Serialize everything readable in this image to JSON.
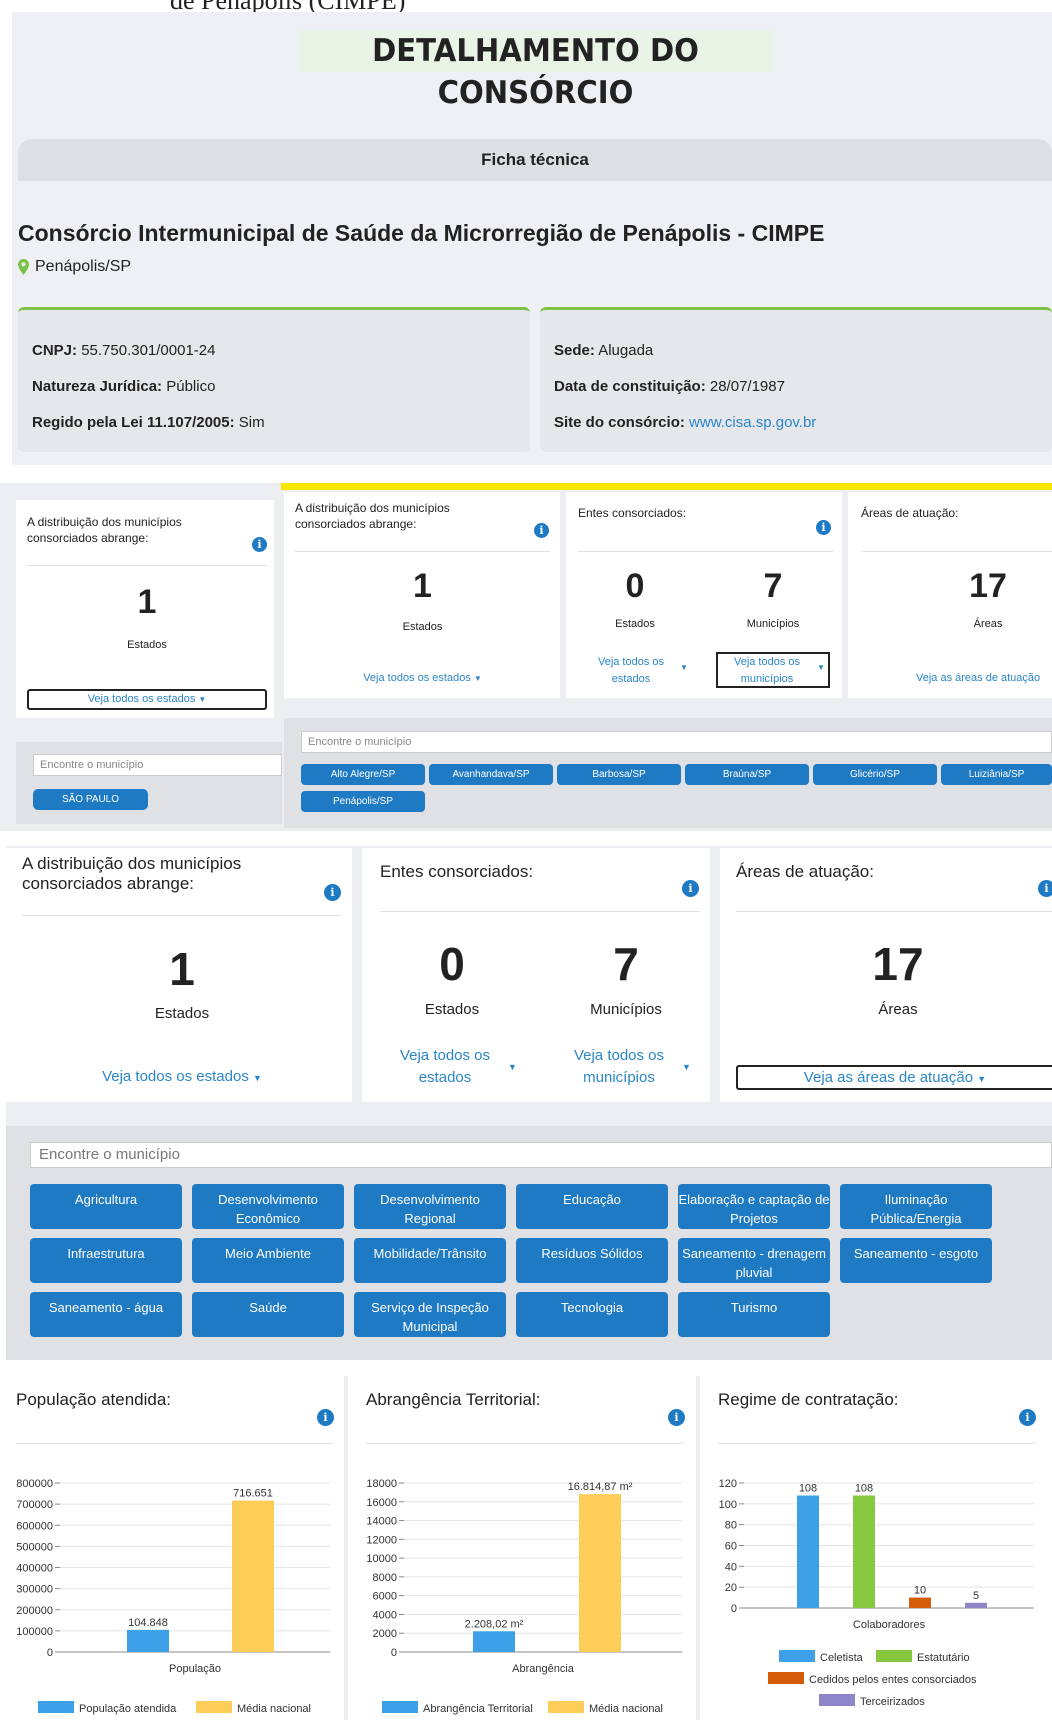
{
  "caption_fragment": "de Penápolis (CIMPE)",
  "header": {
    "title": "DETALHAMENTO DO CONSÓRCIO",
    "tab": "Ficha técnica"
  },
  "consortium": {
    "name": "Consórcio Intermunicipal de Saúde da Microrregião de Penápolis - CIMPE",
    "location": "Penápolis/SP"
  },
  "ficha": {
    "cnpj_label": "CNPJ:",
    "cnpj": "55.750.301/0001-24",
    "natureza_label": "Natureza Jurídica:",
    "natureza": "Público",
    "lei_label": "Regido pela Lei 11.107/2005:",
    "lei": "Sim",
    "sede_label": "Sede:",
    "sede": "Alugada",
    "data_label": "Data de constituição:",
    "data": "28/07/1987",
    "site_label": "Site do consórcio:",
    "site": "www.cisa.sp.gov.br"
  },
  "mid": {
    "dist_label": "A distribuição dos municípios consorciados abrange:",
    "estados_count": "1",
    "estados_label": "Estados",
    "veja_estados": "Veja todos os estados",
    "entes_label": "Entes consorciados:",
    "entes_estados": "0",
    "entes_municipios": "7",
    "municipios_label": "Municípios",
    "veja_estados2": "Veja todos os estados",
    "veja_municipios": "Veja todos os municípios",
    "areas_label": "Áreas de atuação:",
    "areas_count": "17",
    "areas_unit": "Áreas",
    "veja_areas": "Veja as áreas de atuação",
    "search_placeholder": "Encontre o município",
    "state_button": "SÃO PAULO",
    "municipios": [
      "Alto Alegre/SP",
      "Avanhandava/SP",
      "Barbosa/SP",
      "Braúna/SP",
      "Glicério/SP",
      "Luiziânia/SP",
      "Penápolis/SP"
    ]
  },
  "big": {
    "dist_label": "A distribuição dos municípios consorciados abrange:",
    "estados_count": "1",
    "estados_label": "Estados",
    "veja_estados": "Veja todos os estados",
    "entes_label": "Entes consorciados:",
    "entes_estados": "0",
    "entes_municipios": "7",
    "estados_label2": "Estados",
    "municipios_label": "Municípios",
    "veja_estados2": "Veja todos os estados",
    "veja_municipios": "Veja todos os municípios",
    "areas_label": "Áreas de atuação:",
    "areas_count": "17",
    "areas_unit": "Áreas",
    "veja_areas": "Veja as áreas de atuação",
    "search_placeholder": "Encontre o município",
    "areas": [
      "Agricultura",
      "Desenvolvimento Econômico",
      "Desenvolvimento Regional",
      "Educação",
      "Elaboração e captação de Projetos",
      "Iluminação Pública/Energia",
      "Infraestrutura",
      "Meio Ambiente",
      "Mobilidade/Trânsito",
      "Resíduos Sólidos",
      "Saneamento - drenagem pluvial",
      "Saneamento - esgoto",
      "Saneamento - água",
      "Saúde",
      "Serviço de Inspeção Municipal",
      "Tecnologia",
      "Turismo"
    ]
  },
  "colors": {
    "accent": "#1f7ac4",
    "green": "#7cc247",
    "yellow": "#f7e600",
    "bar_blue": "#3ea0e8",
    "bar_yellow": "#fdcd57",
    "bar_green": "#86c83e",
    "bar_orange": "#d35b0a",
    "bar_purple": "#8d86c9"
  },
  "chart_data": [
    {
      "type": "bar",
      "title": "População atendida:",
      "categories": [
        "População"
      ],
      "series": [
        {
          "name": "População atendida",
          "values": [
            104848
          ],
          "label": "104.848"
        },
        {
          "name": "Média nacional",
          "values": [
            716651
          ],
          "label": "716.651"
        }
      ],
      "ylim": [
        0,
        800000
      ],
      "yticks": [
        "0",
        "100000",
        "200000",
        "300000",
        "400000",
        "500000",
        "600000",
        "700000",
        "800000"
      ],
      "xlabel": "População"
    },
    {
      "type": "bar",
      "title": "Abrangência Territorial:",
      "categories": [
        "Abrangência"
      ],
      "series": [
        {
          "name": "Abrangência Territorial",
          "values": [
            2208.02
          ],
          "label": "2.208,02 m²"
        },
        {
          "name": "Média nacional",
          "values": [
            16814.87
          ],
          "label": "16.814,87 m²"
        }
      ],
      "ylim": [
        0,
        18000
      ],
      "yticks": [
        "0",
        "2000",
        "4000",
        "6000",
        "8000",
        "10000",
        "12000",
        "14000",
        "16000",
        "18000"
      ],
      "xlabel": "Abrangência"
    },
    {
      "type": "bar",
      "title": "Regime de contratação:",
      "categories": [
        "Colaboradores"
      ],
      "series": [
        {
          "name": "Celetista",
          "values": [
            108
          ],
          "label": "108"
        },
        {
          "name": "Estatutário",
          "values": [
            108
          ],
          "label": "108"
        },
        {
          "name": "Cedidos pelos entes consorciados",
          "values": [
            10
          ],
          "label": "10"
        },
        {
          "name": "Terceirizados",
          "values": [
            5
          ],
          "label": "5"
        }
      ],
      "ylim": [
        0,
        120
      ],
      "yticks": [
        "0",
        "20",
        "40",
        "60",
        "80",
        "100",
        "120"
      ],
      "xlabel": "Colaboradores"
    }
  ]
}
